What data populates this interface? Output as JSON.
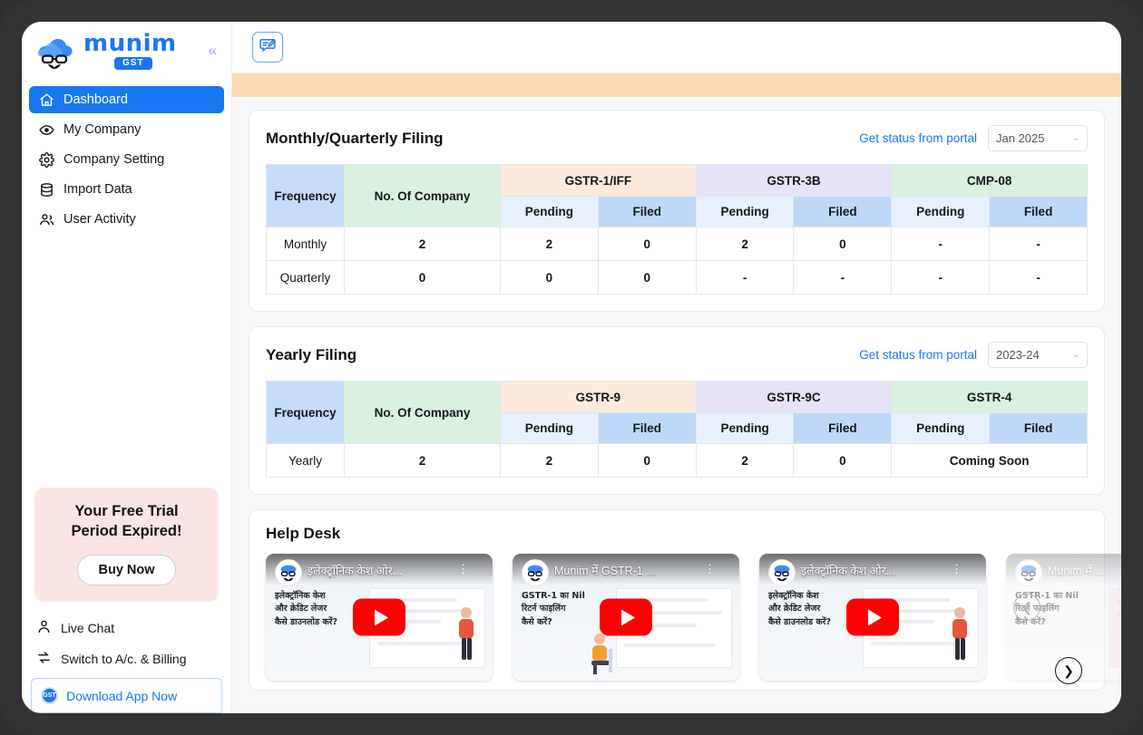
{
  "sidebar": {
    "logo": {
      "word": "munim",
      "badge": "GST"
    },
    "collapse_glyph": "«",
    "items": [
      {
        "label": "Dashboard",
        "icon": "home-icon",
        "active": true
      },
      {
        "label": "My Company",
        "icon": "eye-icon",
        "active": false
      },
      {
        "label": "Company Setting",
        "icon": "gear-icon",
        "active": false
      },
      {
        "label": "Import Data",
        "icon": "database-icon",
        "active": false
      },
      {
        "label": "User Activity",
        "icon": "users-icon",
        "active": false
      }
    ],
    "trial": {
      "line1": "Your Free Trial",
      "line2": "Period Expired!",
      "button": "Buy Now"
    },
    "footer": [
      {
        "label": "Live Chat",
        "icon": "person-chat-icon"
      },
      {
        "label": "Switch to A/c. & Billing",
        "icon": "switch-arrows-icon"
      }
    ],
    "download": {
      "label": "Download App Now",
      "badge": "GST"
    }
  },
  "topbar": {
    "feedback_icon": "feedback-edit-icon"
  },
  "monthly": {
    "title": "Monthly/Quarterly Filing",
    "portal_link": "Get status from portal",
    "period": "Jan 2025",
    "caret": "⌄",
    "headers": {
      "frequency": "Frequency",
      "no_of_company": "No. Of Company",
      "groups": [
        "GSTR-1/IFF",
        "GSTR-3B",
        "CMP-08"
      ],
      "sub": [
        "Pending",
        "Filed"
      ]
    },
    "rows": [
      {
        "frequency": "Monthly",
        "no_of_company": "2",
        "cells": [
          "2",
          "0",
          "2",
          "0",
          "-",
          "-"
        ]
      },
      {
        "frequency": "Quarterly",
        "no_of_company": "0",
        "cells": [
          "0",
          "0",
          "-",
          "-",
          "-",
          "-"
        ]
      }
    ]
  },
  "yearly": {
    "title": "Yearly Filing",
    "portal_link": "Get status from portal",
    "period": "2023-24",
    "caret": "⌄",
    "headers": {
      "frequency": "Frequency",
      "no_of_company": "No. Of Company",
      "groups": [
        "GSTR-9",
        "GSTR-9C",
        "GSTR-4"
      ],
      "sub": [
        "Pending",
        "Filed"
      ]
    },
    "rows": [
      {
        "frequency": "Yearly",
        "no_of_company": "2",
        "cells": [
          "2",
          "0",
          "2",
          "0"
        ],
        "coming_soon": "Coming Soon"
      }
    ]
  },
  "helpdesk": {
    "title": "Help Desk",
    "videos": [
      {
        "title": "इलेक्ट्रॉनिक केश ओर...",
        "overlay": "इलेक्ट्रॉनिक केश\nऔर क्रेडिट लेजर\nकैसे डाउनलोड करें?",
        "kebab": "⋮"
      },
      {
        "title": "Munim में GSTR-1 ...",
        "overlay": "GSTR-1 का Nil\nरिटर्न फाइलिंग\nकैसे करें?",
        "kebab": "⋮"
      },
      {
        "title": "इलेक्ट्रॉनिक केश ओर...",
        "overlay": "इलेक्ट्रॉनिक केश\nऔर क्रेडिट लेजर\nकैसे डाउनलोड करें?",
        "kebab": "⋮"
      },
      {
        "title": "Munim में ...",
        "overlay": "GSTR-1 का Nil\nरिटर्न फाइलिंग\nकैसे करें?",
        "kebab": "⋮"
      }
    ],
    "prev_glyph": "❮",
    "next_glyph": "❯"
  },
  "colors": {
    "accent": "#1877f2",
    "alert_strip": "#fbd9b4",
    "trial_bg": "#fbe4e4",
    "th_frequency": "#c5dcfb",
    "th_company": "#d9f2e0",
    "th_gstr1": "#fdeada",
    "th_gstr3b": "#e6e2f7",
    "th_cmp08": "#d9f2e0",
    "th_pending": "#e6f1fd",
    "th_filed": "#bdd9f7",
    "youtube_red": "#ff0000"
  }
}
